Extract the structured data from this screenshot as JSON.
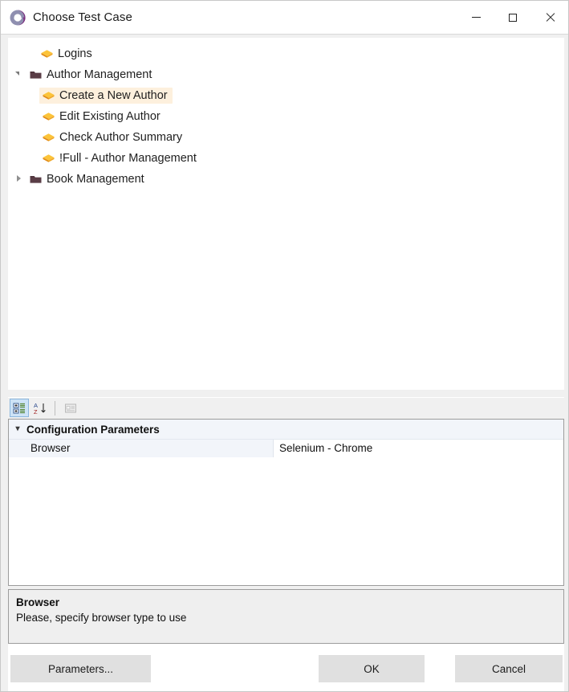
{
  "window": {
    "title": "Choose Test Case",
    "app_icon": "app-logo-icon",
    "controls": {
      "minimize": "minimize-icon",
      "maximize": "maximize-icon",
      "close": "close-icon"
    }
  },
  "tree": {
    "items": [
      {
        "label": "Logins",
        "type": "test-case",
        "depth": 1,
        "expander": "none",
        "selected": false
      },
      {
        "label": "Author Management",
        "type": "folder",
        "depth": 0,
        "expander": "open",
        "selected": false
      },
      {
        "label": "Create a New Author",
        "type": "test-case",
        "depth": 1,
        "expander": "none",
        "selected": true
      },
      {
        "label": "Edit Existing Author",
        "type": "test-case",
        "depth": 1,
        "expander": "none",
        "selected": false
      },
      {
        "label": "Check Author Summary",
        "type": "test-case",
        "depth": 1,
        "expander": "none",
        "selected": false
      },
      {
        "label": "!Full - Author Management",
        "type": "test-case",
        "depth": 1,
        "expander": "none",
        "selected": false
      },
      {
        "label": "Book Management",
        "type": "folder",
        "depth": 0,
        "expander": "closed",
        "selected": false
      }
    ]
  },
  "grid_toolbar": {
    "buttons": [
      {
        "name": "categorized-view-button",
        "state": "active"
      },
      {
        "name": "alphabetical-sort-button",
        "state": "normal"
      },
      {
        "name": "property-pages-button",
        "state": "disabled"
      }
    ]
  },
  "property_grid": {
    "category": "Configuration Parameters",
    "category_expanded": true,
    "rows": [
      {
        "name": "Browser",
        "value": "Selenium - Chrome"
      }
    ]
  },
  "description": {
    "title": "Browser",
    "text": "Please, specify browser type to use"
  },
  "footer": {
    "parameters_label": "Parameters...",
    "ok_label": "OK",
    "cancel_label": "Cancel"
  },
  "colors": {
    "selection": "#fdf0dd",
    "category_row": "#f2f5fa",
    "test_case_icon": "#f0a829",
    "folder_icon": "#5a3d46",
    "toolbar_active": "#cde3f7"
  }
}
